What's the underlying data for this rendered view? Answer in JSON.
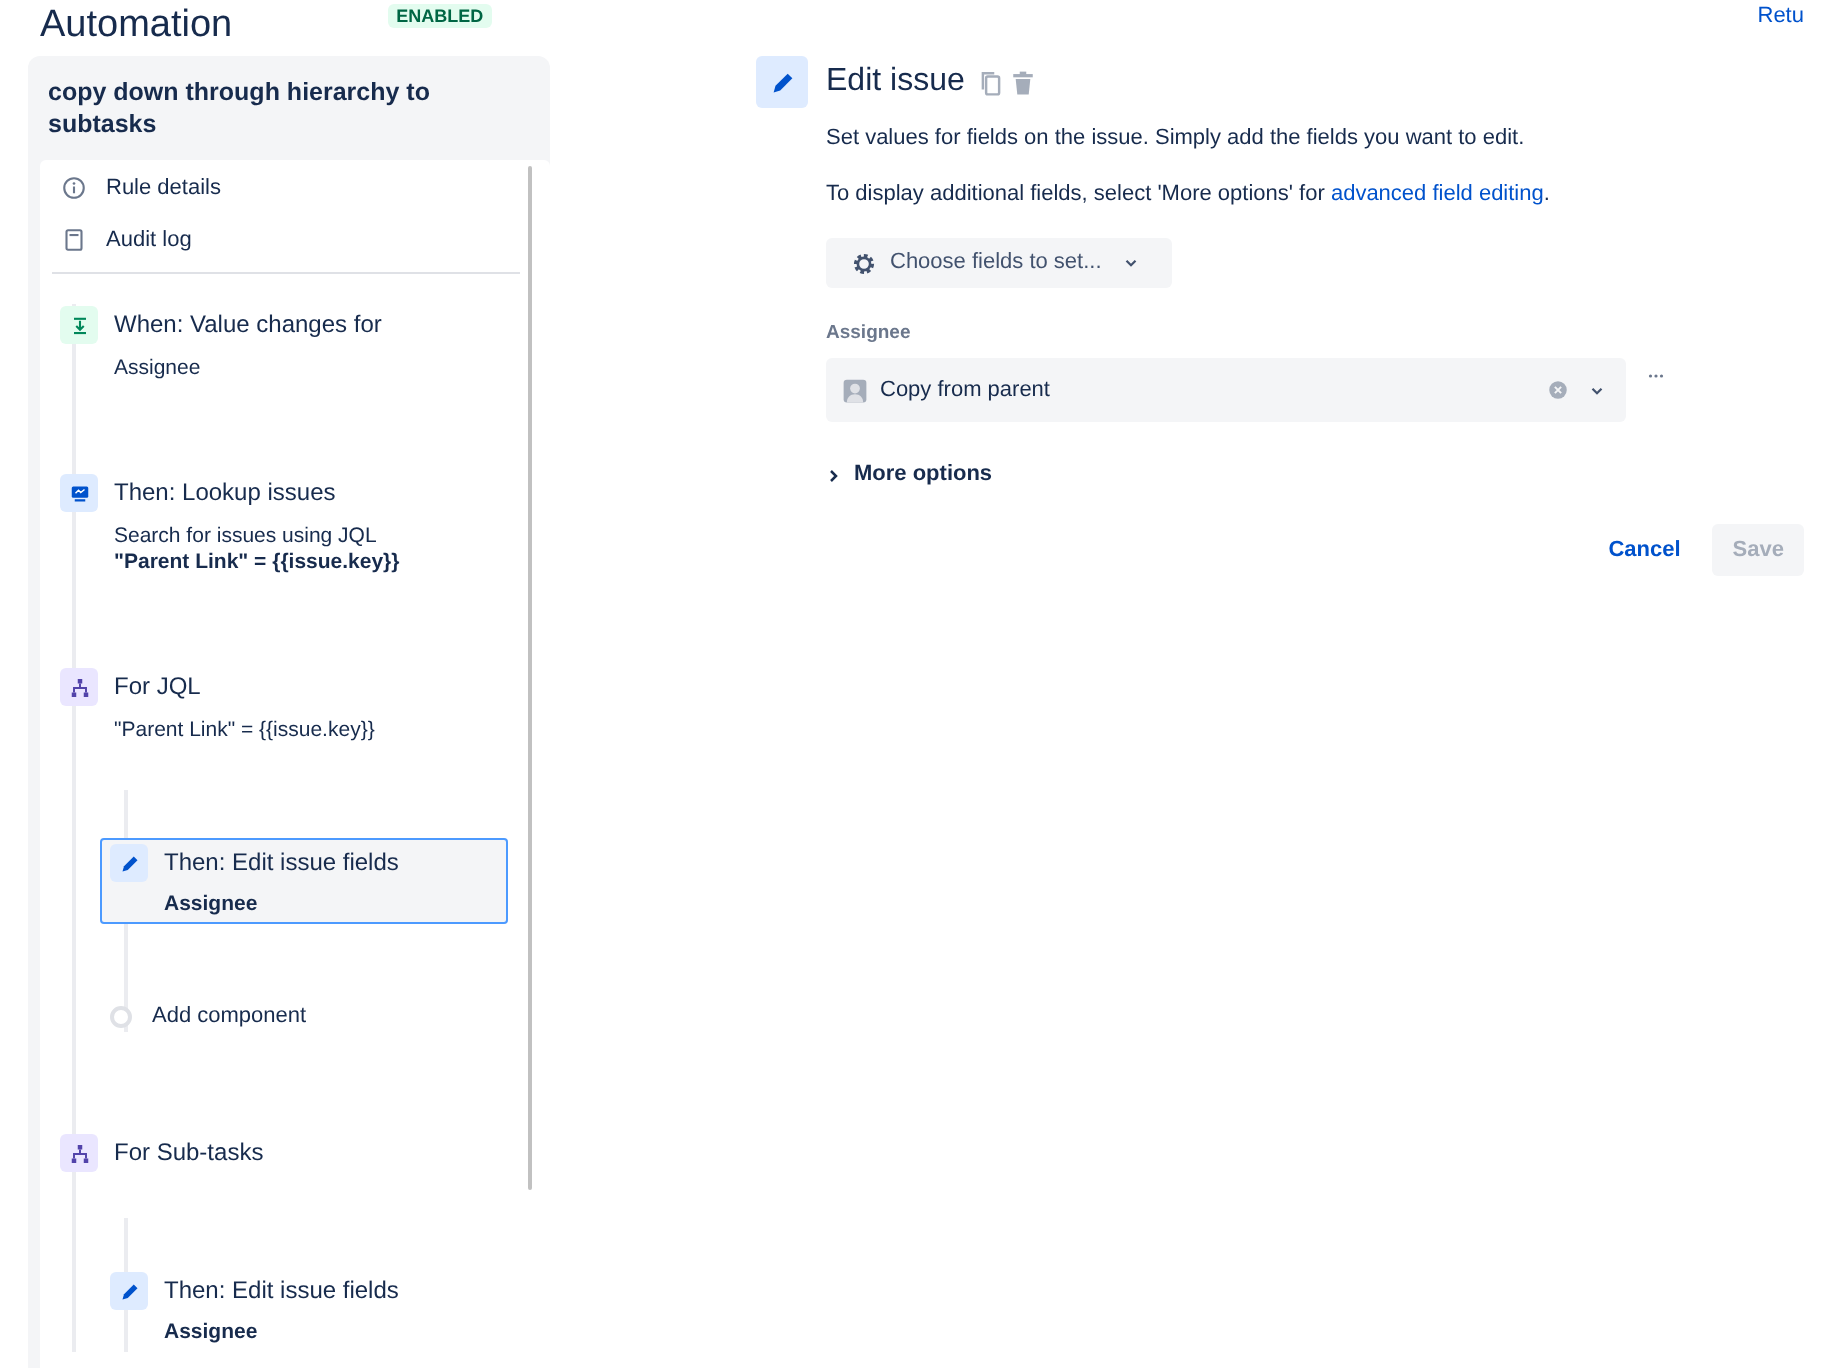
{
  "header": {
    "title": "Automation",
    "badge": "ENABLED",
    "return_link": "Retu"
  },
  "rule": {
    "name": "copy down through hierarchy to subtasks",
    "nav": [
      {
        "kind": "info",
        "label": "Rule details"
      },
      {
        "kind": "log",
        "label": "Audit log"
      }
    ],
    "components": [
      {
        "kind": "trigger",
        "title": "When: Value changes for",
        "detail": "Assignee",
        "selected": false
      },
      {
        "kind": "lookup",
        "title": "Then: Lookup issues",
        "detail": "Search for issues using JQL",
        "detail_strong": "\"Parent Link\" = {{issue.key}}",
        "selected": false
      },
      {
        "kind": "branch",
        "title": "For JQL",
        "detail": "\"Parent Link\" = {{issue.key}}",
        "selected": false,
        "children": [
          {
            "kind": "edit",
            "title": "Then: Edit issue fields",
            "detail_strong": "Assignee",
            "selected": true
          },
          {
            "kind": "add",
            "title": "Add component"
          }
        ]
      },
      {
        "kind": "branch",
        "title": "For Sub-tasks",
        "selected": false,
        "children": [
          {
            "kind": "edit",
            "title": "Then: Edit issue fields",
            "detail_strong": "Assignee",
            "selected": false
          }
        ]
      }
    ]
  },
  "editor": {
    "title": "Edit issue",
    "description": "Set values for fields on the issue. Simply add the fields you want to edit.",
    "note_before": "To display additional fields, select 'More options' for ",
    "note_link": "advanced field editing",
    "note_after": ".",
    "chooser": "Choose fields to set...",
    "field_label": "Assignee",
    "field_value": "Copy from parent",
    "more_options": "More options",
    "buttons": [
      {
        "kind": "cancel",
        "label": "Cancel",
        "disabled": false
      },
      {
        "kind": "save",
        "label": "Save",
        "disabled": true
      }
    ]
  }
}
